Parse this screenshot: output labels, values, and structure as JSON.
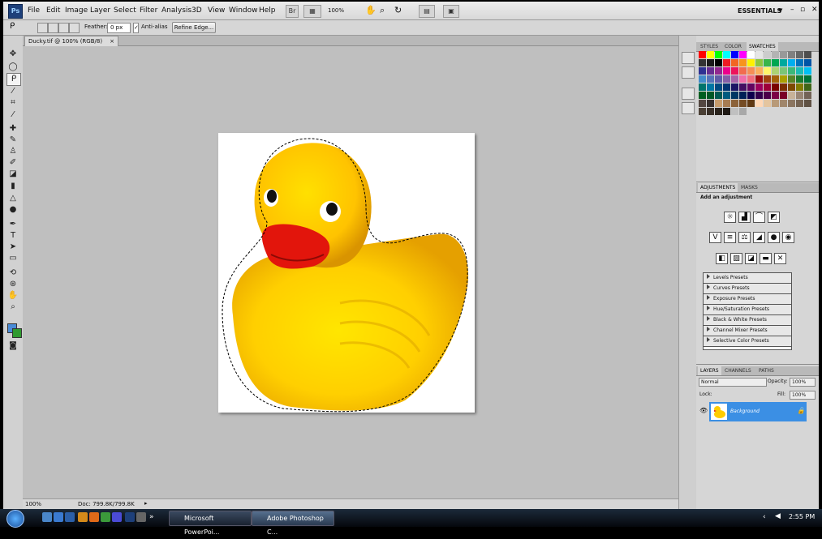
{
  "menubar": {
    "logo": "Ps",
    "items": [
      "File",
      "Edit",
      "Image",
      "Layer",
      "Select",
      "Filter",
      "Analysis",
      "3D",
      "View",
      "Window",
      "Help"
    ],
    "zoom": "100%",
    "workspace": "ESSENTIALS"
  },
  "options": {
    "feather_label": "Feather:",
    "feather_value": "0 px",
    "antialias_label": "Anti-alias",
    "refine_edge": "Refine Edge..."
  },
  "document": {
    "tab_title": "Ducky.tif @ 100% (RGB/8)",
    "zoom": "100%",
    "doc_info": "Doc: 799.8K/799.8K"
  },
  "panels": {
    "swatch_tabs": [
      "STYLES",
      "COLOR",
      "SWATCHES"
    ],
    "adjust_tabs": [
      "ADJUSTMENTS",
      "MASKS"
    ],
    "adjust_title": "Add an adjustment",
    "presets": [
      "Levels Presets",
      "Curves Presets",
      "Exposure Presets",
      "Hue/Saturation Presets",
      "Black & White Presets",
      "Channel Mixer Presets",
      "Selective Color Presets"
    ],
    "layer_tabs": [
      "LAYERS",
      "CHANNELS",
      "PATHS"
    ],
    "blend_mode": "Normal",
    "opacity_label": "Opacity:",
    "opacity_value": "100%",
    "lock_label": "Lock:",
    "fill_label": "Fill:",
    "fill_value": "100%",
    "layer_name": "Background"
  },
  "taskbar": {
    "buttons": [
      "Microsoft PowerPoi...",
      "Adobe Photoshop C..."
    ],
    "clock": "2:55 PM"
  },
  "swatch_colors": [
    "#ff0000",
    "#ffff00",
    "#00ff00",
    "#00ffff",
    "#0000ff",
    "#ff00ff",
    "#ffffff",
    "#e6e6e6",
    "#cccccc",
    "#b3b3b3",
    "#999999",
    "#808080",
    "#666666",
    "#4d4d4d",
    "#333333",
    "#1a1a1a",
    "#000000",
    "#ed1c24",
    "#f26522",
    "#f7941d",
    "#fff200",
    "#8dc63f",
    "#39b54a",
    "#00a651",
    "#00a99d",
    "#00aeef",
    "#0072bc",
    "#0054a6",
    "#2e3192",
    "#662d91",
    "#92278f",
    "#ec008c",
    "#ed145b",
    "#f26c4f",
    "#f68e56",
    "#fbaf5d",
    "#fff568",
    "#acd373",
    "#7cc576",
    "#3cb878",
    "#1cbbb4",
    "#00bff3",
    "#448ccb",
    "#5674b9",
    "#605ca8",
    "#8560a8",
    "#a864a8",
    "#f06eaa",
    "#f26d7d",
    "#9e0b0f",
    "#a0410d",
    "#a3620a",
    "#aba000",
    "#598527",
    "#197b30",
    "#007236",
    "#00746b",
    "#0076a3",
    "#004a80",
    "#003471",
    "#1b1464",
    "#440e62",
    "#630460",
    "#9e005d",
    "#9e0039",
    "#790000",
    "#7b2e00",
    "#7d4900",
    "#827b00",
    "#406618",
    "#005e20",
    "#005826",
    "#005952",
    "#005b7f",
    "#003663",
    "#002157",
    "#0d004c",
    "#32004b",
    "#4b0049",
    "#7b0046",
    "#7a0026",
    "#c7b299",
    "#998675",
    "#736357",
    "#534741",
    "#37302d",
    "#c69c6d",
    "#a67c52",
    "#8c6239",
    "#754c24",
    "#603913",
    "#ffd7b5",
    "#e4c59f",
    "#b89a78",
    "#a0866b",
    "#8b7560",
    "#746352",
    "#5f5143",
    "#4b4035",
    "#382f27",
    "#2a231c",
    "#1e1914",
    "#c0c0c0",
    "#a8a8a8"
  ]
}
